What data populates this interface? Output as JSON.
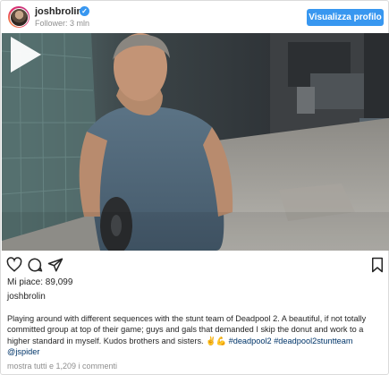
{
  "header": {
    "username": "joshbrolin",
    "followers": "Follower: 3 mln",
    "profile_button": "Visualizza profilo"
  },
  "video": {
    "play_icon": "play-icon"
  },
  "actions": {
    "icons": [
      "heart-icon",
      "comment-icon",
      "share-icon",
      "bookmark-icon"
    ]
  },
  "post": {
    "likes": "Mi piace: 89,099",
    "owner": "joshbrolin",
    "caption_text": "Playing around with different sequences with the stunt team of Deadpool 2. A beautiful, if not totally committed group at top of their game; guys and gals that demanded I skip the donut and work to a higher standard in myself. Kudos brothers and sisters. ✌💪",
    "hashtag1": "#deadpool2",
    "hashtag2": "#deadpool2stuntteam",
    "mention": "@jspider",
    "comments_link": "mostra tutti e 1,209 i commenti"
  },
  "colors": {
    "accent": "#3897f0",
    "link": "#003569",
    "muted": "#8e8e8e"
  }
}
